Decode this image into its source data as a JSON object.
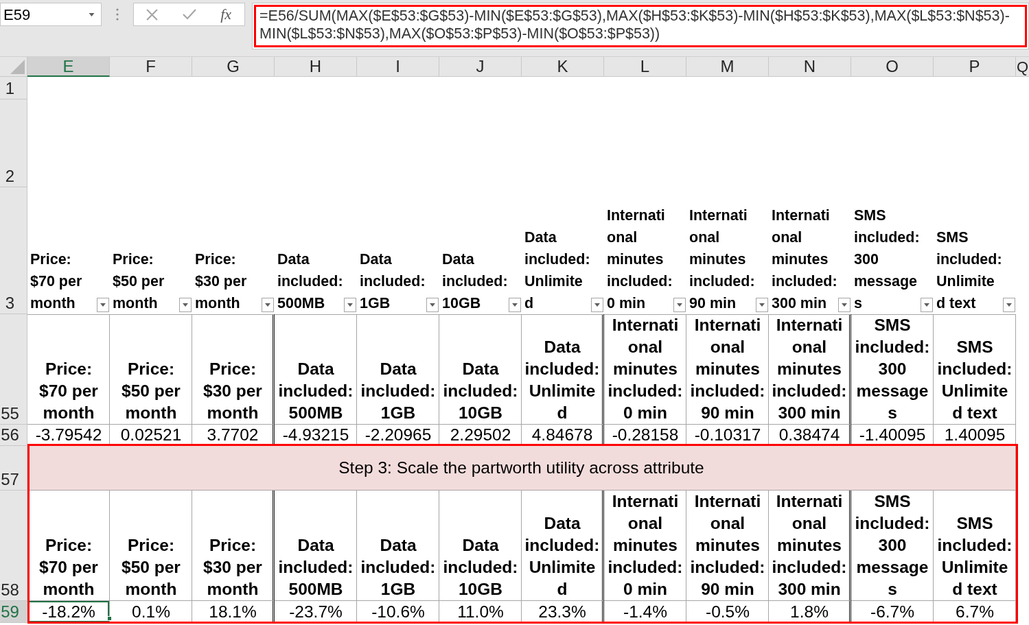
{
  "formula_bar": {
    "name_box": "E59",
    "insert_function": "fx",
    "formula": "=E56/SUM(MAX($E$53:$G$53)-MIN($E$53:$G$53),MAX($H$53:$K$53)-MIN($H$53:$K$53),MAX($L$53:$N$53)-MIN($L$53:$N$53),MAX($O$53:$P$53)-MIN($O$53:$P$53))",
    "highlighted": true
  },
  "column_headers": [
    {
      "label": "E",
      "selected": true
    },
    {
      "label": "F",
      "selected": false
    },
    {
      "label": "G",
      "selected": false
    },
    {
      "label": "H",
      "selected": false
    },
    {
      "label": "I",
      "selected": false
    },
    {
      "label": "J",
      "selected": false
    },
    {
      "label": "K",
      "selected": false
    },
    {
      "label": "L",
      "selected": false
    },
    {
      "label": "M",
      "selected": false
    },
    {
      "label": "N",
      "selected": false
    },
    {
      "label": "O",
      "selected": false
    },
    {
      "label": "P",
      "selected": false
    },
    {
      "label": "Q",
      "selected": false
    }
  ],
  "rows": [
    {
      "number": "1",
      "selected": false,
      "highlighted": false,
      "kind": "blank"
    },
    {
      "number": "2",
      "selected": false,
      "highlighted": false,
      "kind": "blank"
    },
    {
      "number": "3",
      "selected": false,
      "highlighted": false,
      "kind": "filter_header",
      "cells": [
        {
          "text": "Price: $70 per month"
        },
        {
          "text": "Price: $50 per month"
        },
        {
          "text": "Price: $30 per month"
        },
        {
          "text": "Data included: 500MB"
        },
        {
          "text": "Data included: 1GB"
        },
        {
          "text": "Data included: 10GB"
        },
        {
          "text": "Data included: Unlimited"
        },
        {
          "text": "International minutes included: 0 min"
        },
        {
          "text": "International minutes included: 90 min"
        },
        {
          "text": "International minutes included: 300 min"
        },
        {
          "text": "SMS included: 300 messages"
        },
        {
          "text": "SMS included: Unlimited text"
        }
      ]
    },
    {
      "number": "55",
      "selected": false,
      "highlighted": false,
      "kind": "header",
      "cells": [
        {
          "text": "Price: $70 per month",
          "selected": false
        },
        {
          "text": "Price: $50 per month",
          "selected": false
        },
        {
          "text": "Price: $30 per month",
          "selected": false
        },
        {
          "text": "Data included: 500MB",
          "selected": false
        },
        {
          "text": "Data included: 1GB",
          "selected": false
        },
        {
          "text": "Data included: 10GB",
          "selected": false
        },
        {
          "text": "Data included: Unlimited",
          "selected": false
        },
        {
          "text": "International minutes included: 0 min",
          "selected": false
        },
        {
          "text": "International minutes included: 90 min",
          "selected": false
        },
        {
          "text": "International minutes included: 300 min",
          "selected": false
        },
        {
          "text": "SMS included: 300 messages",
          "selected": false
        },
        {
          "text": "SMS included: Unlimited text",
          "selected": false
        }
      ]
    },
    {
      "number": "56",
      "selected": false,
      "highlighted": false,
      "kind": "value",
      "cells": [
        {
          "text": "-3.79542",
          "selected": false
        },
        {
          "text": "0.02521",
          "selected": false
        },
        {
          "text": "3.7702",
          "selected": false
        },
        {
          "text": "-4.93215",
          "selected": false
        },
        {
          "text": "-2.20965",
          "selected": false
        },
        {
          "text": "2.29502",
          "selected": false
        },
        {
          "text": "4.84678",
          "selected": false
        },
        {
          "text": "-0.28158",
          "selected": false
        },
        {
          "text": "-0.10317",
          "selected": false
        },
        {
          "text": "0.38474",
          "selected": false
        },
        {
          "text": "-1.40095",
          "selected": false
        },
        {
          "text": "1.40095",
          "selected": false
        }
      ]
    },
    {
      "number": "57",
      "selected": false,
      "highlighted": true,
      "kind": "banner",
      "text": "Step 3: Scale the partworth utility across attribute"
    },
    {
      "number": "58",
      "selected": false,
      "highlighted": true,
      "kind": "header",
      "cells": [
        {
          "text": "Price: $70 per month",
          "selected": false
        },
        {
          "text": "Price: $50 per month",
          "selected": false
        },
        {
          "text": "Price: $30 per month",
          "selected": false
        },
        {
          "text": "Data included: 500MB",
          "selected": false
        },
        {
          "text": "Data included: 1GB",
          "selected": false
        },
        {
          "text": "Data included: 10GB",
          "selected": false
        },
        {
          "text": "Data included: Unlimited",
          "selected": false
        },
        {
          "text": "International minutes included: 0 min",
          "selected": false
        },
        {
          "text": "International minutes included: 90 min",
          "selected": false
        },
        {
          "text": "International minutes included: 300 min",
          "selected": false
        },
        {
          "text": "SMS included: 300 messages",
          "selected": false
        },
        {
          "text": "SMS included: Unlimited text",
          "selected": false
        }
      ]
    },
    {
      "number": "59",
      "selected": true,
      "highlighted": true,
      "kind": "value",
      "cells": [
        {
          "text": "-18.2%",
          "selected": true
        },
        {
          "text": "0.1%",
          "selected": false
        },
        {
          "text": "18.1%",
          "selected": false
        },
        {
          "text": "-23.7%",
          "selected": false
        },
        {
          "text": "-10.6%",
          "selected": false
        },
        {
          "text": "11.0%",
          "selected": false
        },
        {
          "text": "23.3%",
          "selected": false
        },
        {
          "text": "-1.4%",
          "selected": false
        },
        {
          "text": "-0.5%",
          "selected": false
        },
        {
          "text": "1.8%",
          "selected": false
        },
        {
          "text": "-6.7%",
          "selected": false
        },
        {
          "text": "6.7%",
          "selected": false
        }
      ]
    }
  ]
}
